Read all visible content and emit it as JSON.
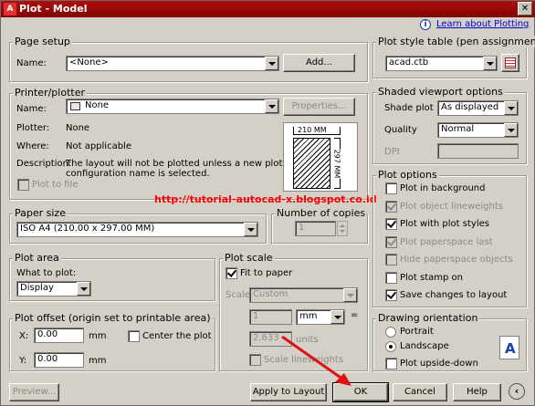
{
  "window": {
    "title": "Plot - Model",
    "app_icon": "A"
  },
  "help": {
    "link": "Learn about Plotting",
    "icon": "info-icon"
  },
  "page_setup": {
    "title": "Page setup",
    "name_label": "Name:",
    "name_value": "<None>",
    "add_button": "Add..."
  },
  "printer": {
    "title": "Printer/plotter",
    "name_label": "Name:",
    "name_value": "None",
    "properties_button": "Properties...",
    "plotter_label": "Plotter:",
    "plotter_value": "None",
    "where_label": "Where:",
    "where_value": "Not applicable",
    "description_label": "Description:",
    "description_line1": "The layout will not be plotted unless a new plotter",
    "description_line2": "configuration name is selected.",
    "plot_to_file": "Plot to file",
    "preview_width": "210 MM",
    "preview_height": "297 MM"
  },
  "paper_size": {
    "title": "Paper size",
    "value": "ISO A4 (210.00 x 297.00 MM)"
  },
  "copies": {
    "title": "Number of copies",
    "value": "1"
  },
  "plot_area": {
    "title": "Plot area",
    "what_label": "What to plot:",
    "what_value": "Display"
  },
  "plot_offset": {
    "title": "Plot offset (origin set to printable area)",
    "x_label": "X:",
    "x_value": "0.00",
    "x_unit": "mm",
    "y_label": "Y:",
    "y_value": "0.00",
    "y_unit": "mm",
    "center_label": "Center the plot"
  },
  "plot_scale": {
    "title": "Plot scale",
    "fit_label": "Fit to paper",
    "scale_label": "Scale:",
    "scale_value": "Custom",
    "num_value": "1",
    "unit_value": "mm",
    "equals": "=",
    "den_value": "2.633",
    "den_unit": "units",
    "lineweights_label": "Scale lineweights"
  },
  "plot_style": {
    "title": "Plot style table (pen assignments)",
    "value": "acad.ctb",
    "edit_icon": "edit-table-icon"
  },
  "shaded": {
    "title": "Shaded viewport options",
    "shade_label": "Shade plot",
    "shade_value": "As displayed",
    "quality_label": "Quality",
    "quality_value": "Normal",
    "dpi_label": "DPI"
  },
  "plot_options": {
    "title": "Plot options",
    "items": [
      {
        "label": "Plot in background",
        "checked": false,
        "disabled": false
      },
      {
        "label": "Plot object lineweights",
        "checked": true,
        "disabled": true
      },
      {
        "label": "Plot with plot styles",
        "checked": true,
        "disabled": false
      },
      {
        "label": "Plot paperspace last",
        "checked": true,
        "disabled": true
      },
      {
        "label": "Hide paperspace objects",
        "checked": false,
        "disabled": true
      },
      {
        "label": "Plot stamp on",
        "checked": false,
        "disabled": false
      },
      {
        "label": "Save changes to layout",
        "checked": true,
        "disabled": false
      }
    ]
  },
  "orientation": {
    "title": "Drawing orientation",
    "portrait": "Portrait",
    "landscape": "Landscape",
    "upside_down": "Plot upside-down",
    "icon_letter": "A"
  },
  "footer": {
    "preview": "Preview...",
    "apply": "Apply to Layout",
    "ok": "OK",
    "cancel": "Cancel",
    "help": "Help",
    "expand_icon": "chevron-left-icon"
  },
  "watermark": "http://tutorial-autocad-x.blogspot.co.id"
}
